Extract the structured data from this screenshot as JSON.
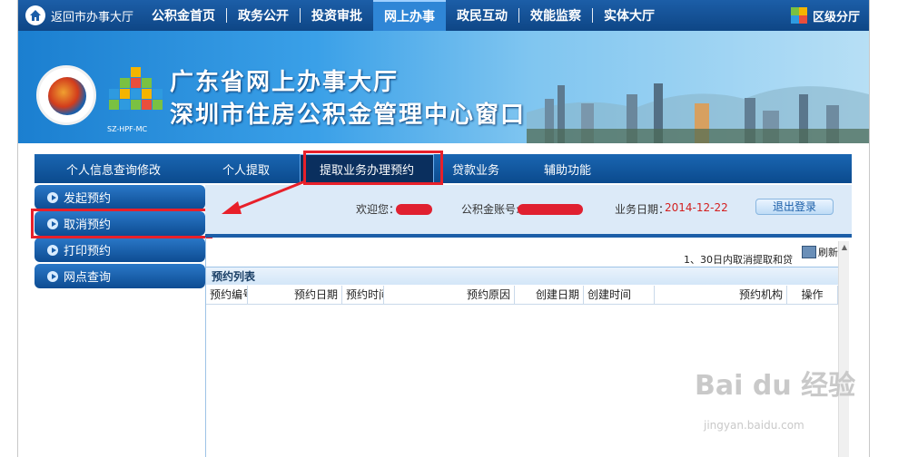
{
  "topbar": {
    "home_label": "返回市办事大厅",
    "nav": [
      "公积金首页",
      "政务公开",
      "投资审批",
      "网上办事",
      "政民互动",
      "效能监察",
      "实体大厅"
    ],
    "active_index": 3,
    "region_label": "区级分厅"
  },
  "banner": {
    "title_line1": "广东省网上办事大厅",
    "title_line2": "深圳市住房公积金管理中心窗口",
    "logo_caption": "SZ-HPF-MC"
  },
  "subnav": {
    "items": [
      "个人信息查询修改",
      "个人提取",
      "提取业务办理预约",
      "贷款业务",
      "辅助功能"
    ],
    "active_index": 2
  },
  "sidebar": {
    "items": [
      "发起预约",
      "取消预约",
      "打印预约",
      "网点查询"
    ]
  },
  "infobar": {
    "welcome_label": "欢迎您：",
    "account_label": "公积金账号:",
    "date_label": "业务日期：",
    "date_value": "2014-12-22",
    "logout_label": "退出登录"
  },
  "main": {
    "notice": "1、30日内取消提取和贷",
    "refresh_label": "刷新",
    "list_title": "预约列表",
    "columns": [
      "预约编号",
      "预约日期",
      "预约时间",
      "预约原因",
      "创建日期",
      "创建时间",
      "预约机构",
      "操作"
    ]
  },
  "watermark": {
    "text": "Bai du 经验",
    "sub": "jingyan.baidu.com"
  },
  "colors": {
    "accent_red": "#e8202a",
    "nav_blue": "#1c5ea8"
  }
}
